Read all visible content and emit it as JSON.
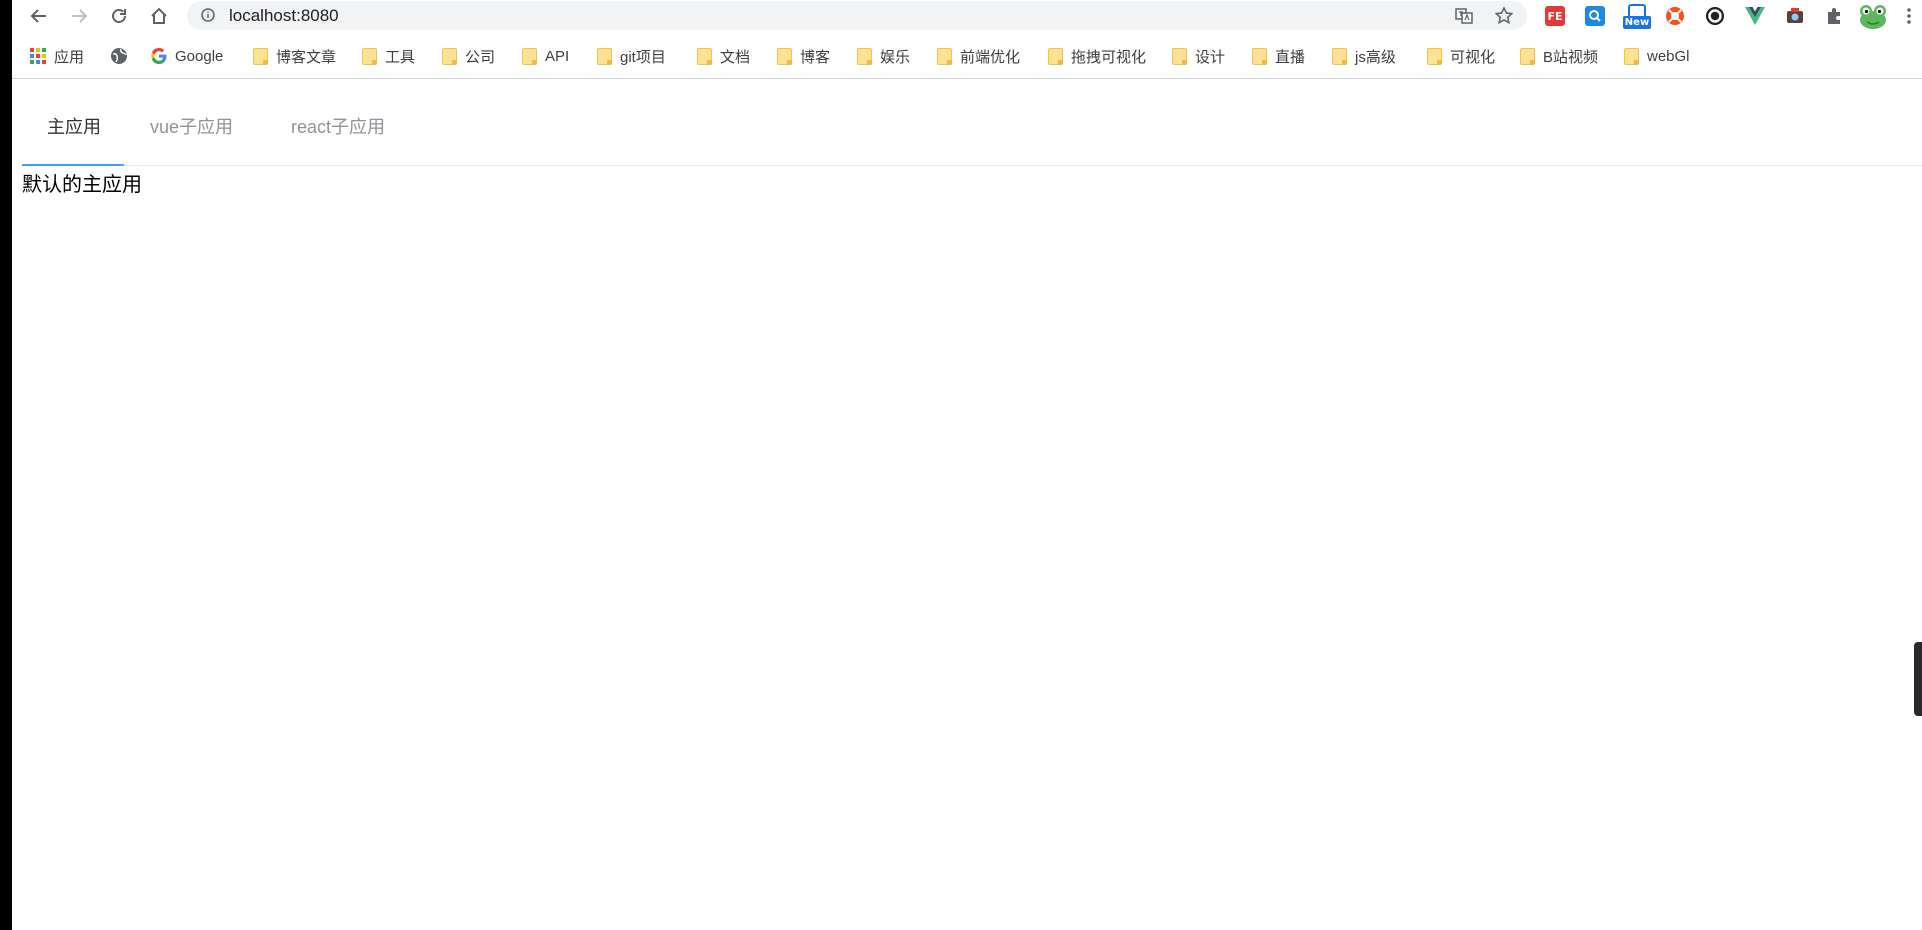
{
  "browser": {
    "url": "localhost:8080",
    "extensions": {
      "new_badge": "New",
      "fe_label": "FE"
    }
  },
  "bookmarks": [
    {
      "label": "应用",
      "icon": "apps-grid-icon"
    },
    {
      "label": "",
      "icon": "globe-icon"
    },
    {
      "label": "Google",
      "icon": "google-icon"
    },
    {
      "label": "博客文章",
      "icon": "folder-icon"
    },
    {
      "label": "工具",
      "icon": "folder-icon"
    },
    {
      "label": "公司",
      "icon": "folder-icon"
    },
    {
      "label": "API",
      "icon": "folder-icon"
    },
    {
      "label": "git项目",
      "icon": "folder-icon"
    },
    {
      "label": "文档",
      "icon": "folder-icon"
    },
    {
      "label": "博客",
      "icon": "folder-icon"
    },
    {
      "label": "娱乐",
      "icon": "folder-icon"
    },
    {
      "label": "前端优化",
      "icon": "folder-icon"
    },
    {
      "label": "拖拽可视化",
      "icon": "folder-icon"
    },
    {
      "label": "设计",
      "icon": "folder-icon"
    },
    {
      "label": "直播",
      "icon": "folder-icon"
    },
    {
      "label": "js高级",
      "icon": "folder-icon"
    },
    {
      "label": "可视化",
      "icon": "folder-icon"
    },
    {
      "label": "B站视频",
      "icon": "folder-icon"
    },
    {
      "label": "webGl",
      "icon": "folder-icon"
    }
  ],
  "page": {
    "tabs": [
      {
        "label": "主应用",
        "active": true
      },
      {
        "label": "vue子应用",
        "active": false
      },
      {
        "label": "react子应用",
        "active": false
      }
    ],
    "content_text": "默认的主应用"
  },
  "colors": {
    "tab_active_ink": "#409eff",
    "tab_inactive_text": "#909399",
    "tab_active_text": "#303133"
  }
}
